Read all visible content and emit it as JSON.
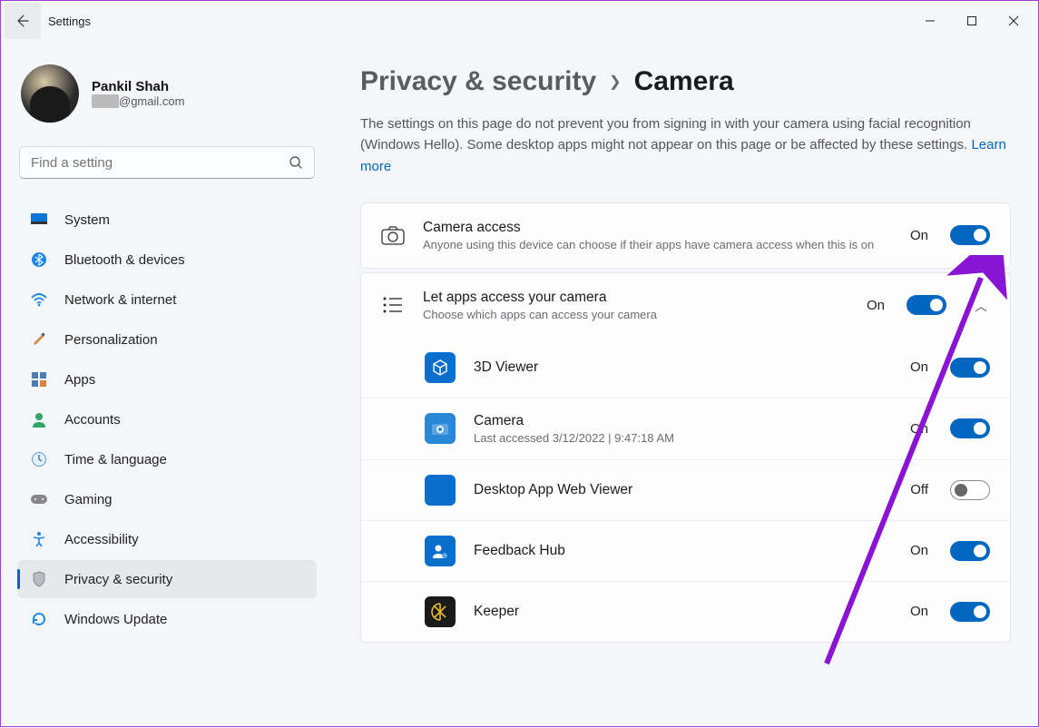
{
  "app": {
    "title": "Settings"
  },
  "profile": {
    "name": "Pankil Shah",
    "email_domain": "@gmail.com"
  },
  "search": {
    "placeholder": "Find a setting"
  },
  "sidebar": {
    "items": [
      {
        "id": "system",
        "label": "System"
      },
      {
        "id": "bluetooth",
        "label": "Bluetooth & devices"
      },
      {
        "id": "network",
        "label": "Network & internet"
      },
      {
        "id": "personalization",
        "label": "Personalization"
      },
      {
        "id": "apps",
        "label": "Apps"
      },
      {
        "id": "accounts",
        "label": "Accounts"
      },
      {
        "id": "time",
        "label": "Time & language"
      },
      {
        "id": "gaming",
        "label": "Gaming"
      },
      {
        "id": "accessibility",
        "label": "Accessibility"
      },
      {
        "id": "privacy",
        "label": "Privacy & security",
        "selected": true
      },
      {
        "id": "update",
        "label": "Windows Update"
      }
    ]
  },
  "breadcrumb": {
    "parent": "Privacy & security",
    "current": "Camera"
  },
  "description": {
    "text": "The settings on this page do not prevent you from signing in with your camera using facial recognition (Windows Hello). Some desktop apps might not appear on this page or be affected by these settings.  ",
    "learn_more": "Learn more"
  },
  "camera_access": {
    "title": "Camera access",
    "subtitle": "Anyone using this device can choose if their apps have camera access when this is on",
    "state_label": "On",
    "state": "on"
  },
  "let_apps": {
    "title": "Let apps access your camera",
    "subtitle": "Choose which apps can access your camera",
    "state_label": "On",
    "state": "on",
    "expanded": true
  },
  "apps": [
    {
      "name": "3D Viewer",
      "state_label": "On",
      "state": "on",
      "icon_bg": "#0a6ecd",
      "icon_glyph": "cube"
    },
    {
      "name": "Camera",
      "sub": "Last accessed 3/12/2022  |  9:47:18 AM",
      "state_label": "On",
      "state": "on",
      "icon_bg": "#2a87d8",
      "icon_glyph": "camera"
    },
    {
      "name": "Desktop App Web Viewer",
      "state_label": "Off",
      "state": "off",
      "icon_bg": "#0a6ecd",
      "icon_glyph": "blank"
    },
    {
      "name": "Feedback Hub",
      "state_label": "On",
      "state": "on",
      "icon_bg": "#0a6ecd",
      "icon_glyph": "person"
    },
    {
      "name": "Keeper",
      "state_label": "On",
      "state": "on",
      "icon_bg": "#1a1a1a",
      "icon_glyph": "keeper"
    }
  ]
}
